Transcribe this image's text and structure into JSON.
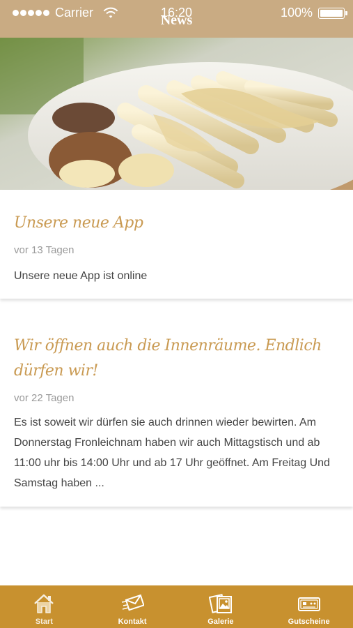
{
  "status_bar": {
    "carrier": "Carrier",
    "time": "16:20",
    "battery": "100%"
  },
  "nav": {
    "title": "News"
  },
  "colors": {
    "header": "#c9ab83",
    "tab_bar": "#c8912f",
    "title_accent": "#c99a52"
  },
  "news": [
    {
      "title": "Unsere neue App",
      "date": "vor 13 Tagen",
      "body": "Unsere neue App ist online"
    },
    {
      "title": "Wir öffnen auch die Innenräume. Endlich dürfen wir!",
      "date": "vor 22 Tagen",
      "body": "Es ist soweit wir dürfen sie auch drinnen wieder bewirten. Am Donnerstag Fronleichnam haben wir auch Mittagstisch und ab 11:00 uhr bis 14:00 Uhr und ab 17 Uhr geöffnet. Am Freitag Und Samstag haben ..."
    }
  ],
  "tabs": [
    {
      "label": "Start",
      "icon": "home-icon",
      "active": true
    },
    {
      "label": "Kontakt",
      "icon": "envelope-icon"
    },
    {
      "label": "Galerie",
      "icon": "gallery-icon"
    },
    {
      "label": "Gutscheine",
      "icon": "voucher-icon"
    }
  ]
}
